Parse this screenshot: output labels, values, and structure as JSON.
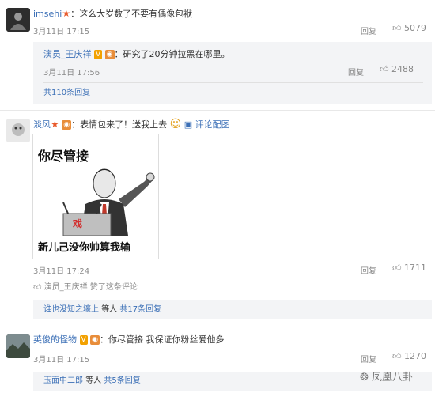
{
  "comments": [
    {
      "user": "imsehi",
      "text": "：这么大岁数了不要有偶像包袱",
      "time": "3月11日 17:15",
      "reply_label": "回复",
      "likes": "5079"
    },
    {
      "user": "淡风",
      "text": "：表情包来了！送我上去",
      "image_link": "评论配图",
      "time": "3月11日 17:24",
      "reply_label": "回复",
      "likes": "1711",
      "liked_by": "演员_王庆祥 赞了这条评论",
      "meme": {
        "top_text": "你尽管接",
        "sign_text": "戏",
        "bottom_text": "新儿己没你帅算我输"
      }
    },
    {
      "user": "英俊的怪物",
      "text": "：你尽管接 我保证你粉丝爱他多",
      "time": "3月11日 17:15",
      "reply_label": "回复",
      "likes": "1270"
    }
  ],
  "replies": [
    {
      "user": "演员_王庆祥",
      "text": "：研究了20分钟拉黑在哪里。",
      "time": "3月11日 17:56",
      "reply_label": "回复",
      "likes": "2488"
    }
  ],
  "reply_summaries": {
    "first_total": "共110条回复",
    "second_users": "谁也没知之壕上",
    "second_suffix": "等人",
    "second_total": "共17条回复",
    "third_users": "玉面中二郎",
    "third_suffix": "等人",
    "third_total": "共5条回复"
  },
  "watermark": "凤凰八卦",
  "colors": {
    "link": "#3b6fb6",
    "verified_badge": "#f2a100",
    "star": "#e85a2c"
  }
}
